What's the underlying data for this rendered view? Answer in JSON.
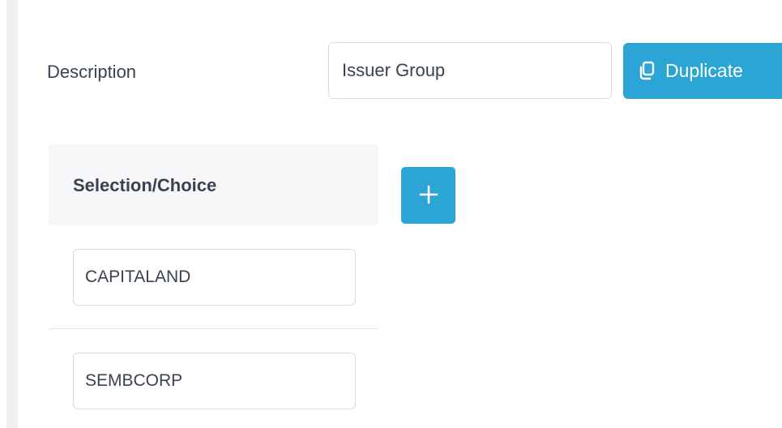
{
  "form": {
    "description_label": "Description",
    "description_value": "Issuer Group",
    "duplicate_label": "Duplicate"
  },
  "table": {
    "header": "Selection/Choice",
    "rows": [
      {
        "value": "CAPITALAND"
      },
      {
        "value": "SEMBCORP"
      }
    ]
  },
  "icons": {
    "duplicate": "copy-icon",
    "add": "plus-icon"
  },
  "colors": {
    "accent": "#2ba4d6",
    "header_bg": "#f6f7f9",
    "text": "#3a4250"
  }
}
